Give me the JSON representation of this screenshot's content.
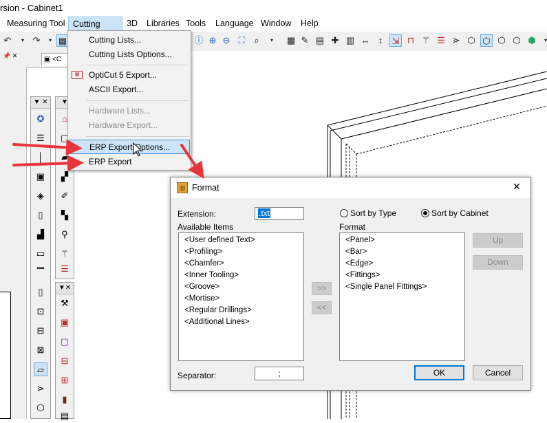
{
  "window": {
    "title": "rsion - Cabinet1"
  },
  "menubar": {
    "items": [
      "Measuring Tool",
      "Cutting Lists",
      "3D",
      "Libraries",
      "Tools",
      "Language",
      "Window",
      "Help"
    ],
    "active": "Cutting Lists"
  },
  "dropdown": {
    "items": [
      {
        "label": "Cutting Lists...",
        "disabled": false
      },
      {
        "label": "Cutting Lists Options...",
        "disabled": false
      },
      {
        "label": "OptiCut 5 Export...",
        "disabled": false
      },
      {
        "label": "ASCII Export...",
        "disabled": false
      },
      {
        "label": "Hardware Lists...",
        "disabled": true
      },
      {
        "label": "Hardware Export...",
        "disabled": true
      },
      {
        "label": "ERP Export Options...",
        "disabled": false,
        "highlighted": true
      },
      {
        "label": "ERP Export",
        "disabled": false
      }
    ]
  },
  "dialog": {
    "title": "Format",
    "extension_label": "Extension:",
    "extension_value": ".txt",
    "sort_by_type": "Sort by Type",
    "sort_by_cabinet": "Sort by Cabinet",
    "selected_sort": "Sort by Cabinet",
    "available_label": "Available Items",
    "format_label": "Format",
    "available_items": [
      "<User defined Text>",
      "<Profiling>",
      "<Chamfer>",
      "<Inner Tooling>",
      "<Groove>",
      "<Mortise>",
      "<Regular Drillings>",
      "<Additional Lines>"
    ],
    "format_items": [
      "<Panel>",
      "<Bar>",
      "<Edge>",
      "<Fittings>",
      "<Single Panel Fittings>"
    ],
    "move_right": ">>",
    "move_left": "<<",
    "up": "Up",
    "down": "Down",
    "separator_label": "Separator:",
    "separator_value": ";",
    "ok": "OK",
    "cancel": "Cancel",
    "close_glyph": "✕"
  },
  "colors": {
    "arrow": "#e8353b",
    "highlight": "#cce4f7",
    "accent": "#0078d7"
  }
}
